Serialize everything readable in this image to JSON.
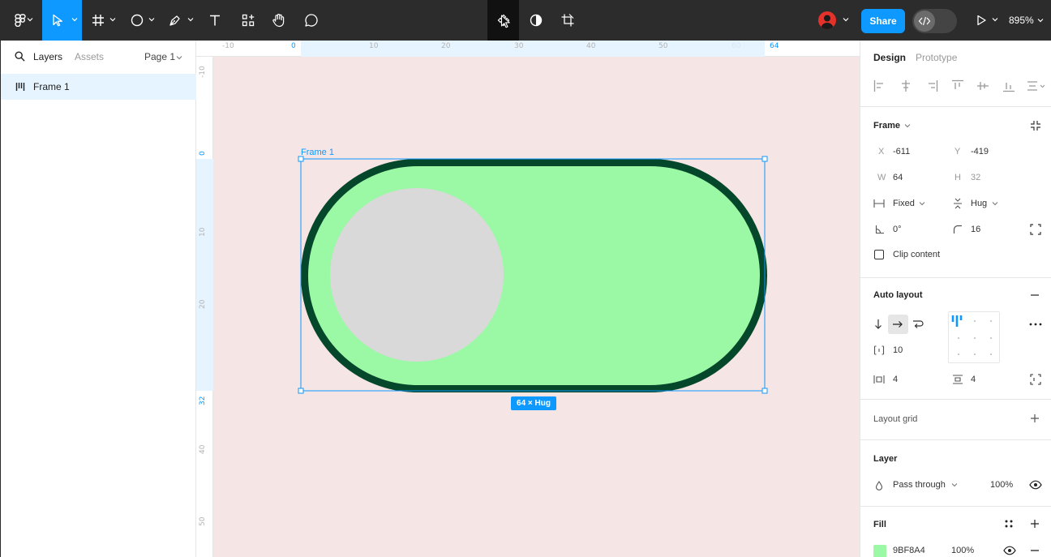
{
  "toolbar": {
    "share_label": "Share",
    "zoom_label": "895%",
    "tools": [
      "main-menu",
      "move",
      "frame",
      "shape",
      "pen",
      "text",
      "resources",
      "hand",
      "comment"
    ],
    "center_tools": [
      "component",
      "mask",
      "crop"
    ]
  },
  "left_panel": {
    "tab_layers": "Layers",
    "tab_assets": "Assets",
    "page_label": "Page 1",
    "layers": [
      {
        "name": "Frame 1",
        "type": "frame-auto-layout"
      }
    ]
  },
  "ruler_h": [
    "-10",
    "0",
    "10",
    "20",
    "30",
    "40",
    "50",
    "60",
    "64"
  ],
  "ruler_v": [
    "-10",
    "0",
    "10",
    "20",
    "32",
    "40",
    "50"
  ],
  "canvas": {
    "frame_label": "Frame 1",
    "size_badge": "64 × Hug",
    "colors": {
      "track_fill": "#9BF8A4",
      "track_stroke": "#05472A",
      "knob": "#D9D9D9",
      "background": "#F5E5E5",
      "selection": "#0D99FF"
    }
  },
  "right_panel": {
    "tab_design": "Design",
    "tab_prototype": "Prototype",
    "frame_section": "Frame",
    "x_label": "X",
    "x_value": "-611",
    "y_label": "Y",
    "y_value": "-419",
    "w_label": "W",
    "w_value": "64",
    "h_label": "H",
    "h_value": "32",
    "width_mode": "Fixed",
    "height_mode": "Hug",
    "rotation": "0°",
    "radius": "16",
    "clip_content": "Clip content",
    "auto_layout": "Auto layout",
    "gap": "10",
    "padding_h": "4",
    "padding_v": "4",
    "layout_grid": "Layout grid",
    "layer_section": "Layer",
    "blend_mode": "Pass through",
    "layer_opacity": "100%",
    "fill_section": "Fill",
    "fill_hex": "9BF8A4",
    "fill_opacity": "100%"
  }
}
